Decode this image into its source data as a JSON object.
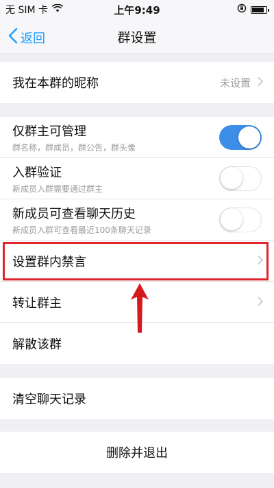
{
  "status_bar": {
    "carrier": "无 SIM 卡",
    "time": "上午9:49",
    "battery_level": 0.85
  },
  "nav": {
    "back_label": "返回",
    "title": "群设置"
  },
  "nickname_row": {
    "label": "我在本群的昵称",
    "value": "未设置"
  },
  "permissions": {
    "owner_only": {
      "label": "仅群主可管理",
      "sub": "群名称，群成员，群公告，群头像",
      "enabled": true
    },
    "join_verify": {
      "label": "入群验证",
      "sub": "新成员入群需要通过群主",
      "enabled": false
    },
    "history_visible": {
      "label": "新成员可查看聊天历史",
      "sub": "新成员入群可查看最近100条聊天记录",
      "enabled": false
    }
  },
  "mute_row": {
    "label": "设置群内禁言"
  },
  "transfer_row": {
    "label": "转让群主"
  },
  "dissolve_row": {
    "label": "解散该群"
  },
  "clear_row": {
    "label": "清空聊天记录"
  },
  "delete_row": {
    "label": "删除并退出"
  },
  "colors": {
    "accent": "#1a9dff",
    "toggle_on": "#3c8ee8",
    "highlight": "#e0242b"
  }
}
